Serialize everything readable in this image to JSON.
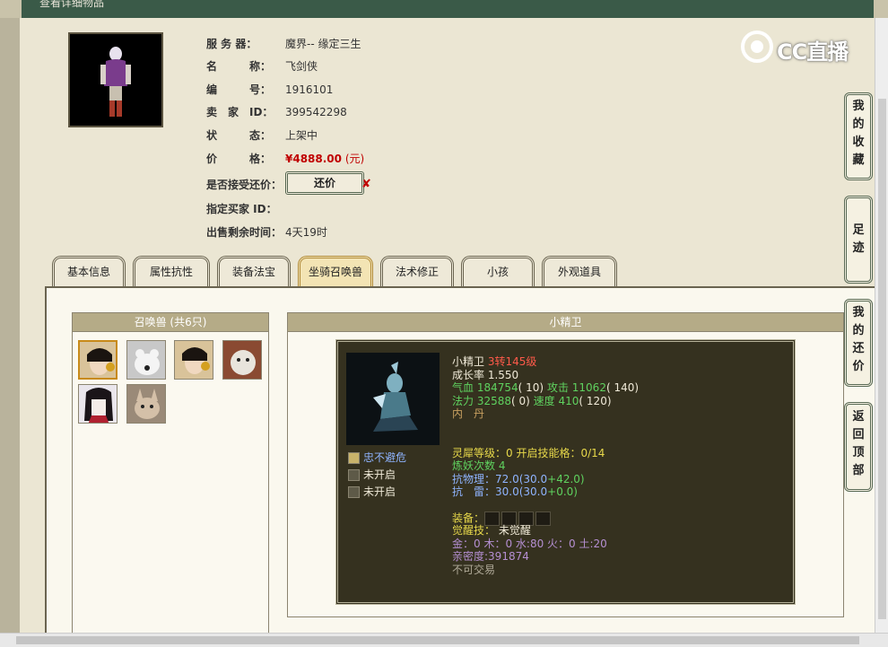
{
  "header": {
    "title": "查看详细物品"
  },
  "logo": {
    "text": "CC直播"
  },
  "item": {
    "server_label": "服 务 器：",
    "server": "魔界-- 缘定三生",
    "name_label": "名　　　称：",
    "name": "飞剑侠",
    "number_label": "编　　　号：",
    "number": "1916101",
    "seller_label": "卖　家　ID：",
    "seller_id": "399542298",
    "status_label": "状　　　态：",
    "status": "上架中",
    "price_label": "价　　　格：",
    "price": "¥4888.00",
    "price_unit": "(元)",
    "counter_label": "是否接受还价：",
    "counter_button": "还价",
    "counter_mark": "✘",
    "buyer_label": "指定买家 ID：",
    "buyer_id": "",
    "time_label": "出售剩余时间：",
    "time_left": "4天19时"
  },
  "tabs": [
    "基本信息",
    "属性抗性",
    "装备法宝",
    "坐骑召唤兽",
    "法术修正",
    "小孩",
    "外观道具"
  ],
  "active_tab": "坐骑召唤兽",
  "pets_panel": {
    "title": "召唤兽 (共6只)"
  },
  "pet_detail": {
    "title": "小精卫",
    "name": "小精卫",
    "level": "3转145级",
    "growth": "成长率 1.550",
    "hp_label": "气血",
    "hp": "184754",
    "hp_bonus": "( 10)",
    "atk_label": "攻击",
    "atk": "11062",
    "atk_bonus": "( 140)",
    "mp_label": "法力",
    "mp": "32588",
    "mp_bonus": "( 0)",
    "spd_label": "速度",
    "spd": "410",
    "spd_bonus": "( 120)",
    "neidan": "内　丹",
    "skills": [
      "忠不避危",
      "未开启",
      "未开启"
    ],
    "soul_level": "灵犀等级：0 开启技能格：0/14",
    "refine": "炼妖次数 4",
    "phys_res_label": "抗物理：",
    "phys_res_base": "72.0(30.0",
    "phys_res_add": "+42.0)",
    "thunder_res_label": "抗　雷：",
    "thunder_res_base": "30.0(30.0",
    "thunder_res_add": "+0.0)",
    "equip_label": "装备：",
    "awaken_label": "觉醒技：",
    "awaken_value": "未觉醒",
    "elements": "金：0 木：0 水:80 火：0 土:20",
    "intimacy": "亲密度:391874",
    "trade": "不可交易"
  },
  "side_buttons": [
    {
      "chars": [
        "我",
        "的",
        "收",
        "藏"
      ]
    },
    {
      "chars": [
        "足",
        "迹"
      ]
    },
    {
      "chars": [
        "我",
        "的",
        "还",
        "价"
      ]
    },
    {
      "chars": [
        "返",
        "回",
        "顶",
        "部"
      ]
    }
  ],
  "colors": {
    "dark_panel": "#35311f",
    "price": "#c00000",
    "header_bg": "#3a5a48",
    "level": "#ff5a4a",
    "stat": "#5fd25f",
    "soul": "#e7d84a"
  }
}
